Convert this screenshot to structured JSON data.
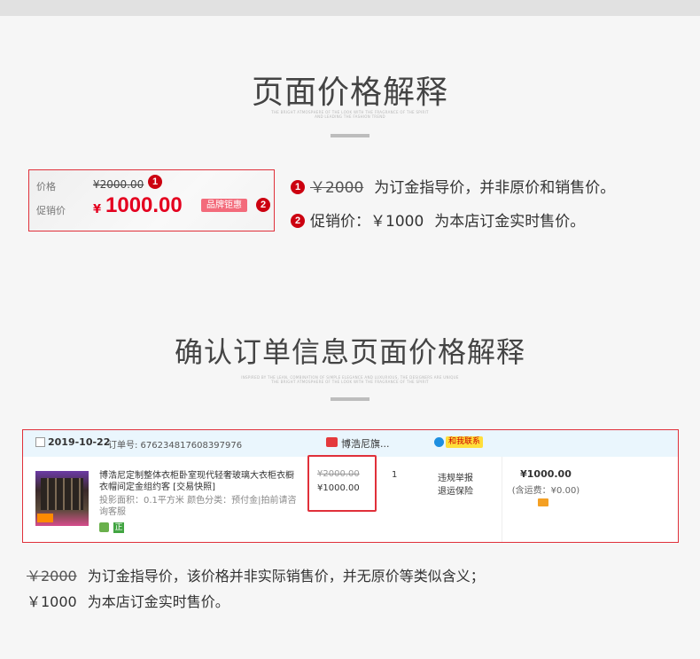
{
  "section1": {
    "title": "页面价格解释",
    "subtitle_lines": [
      "THE BRIGHT ATMOSPHERE OF THE LOOK WITH THE FRAGRANCE OF THE SPIRIT",
      "AND LEADING THE FASHION TREND"
    ],
    "price_box": {
      "price_label": "价格",
      "original_price": "¥2000.00",
      "promo_label": "促销价",
      "currency": "¥",
      "promo_price": "1000.00",
      "tag": "品牌钜惠",
      "marker1": "1",
      "marker2": "2"
    },
    "explanations": [
      {
        "marker": "1",
        "strike_value": "￥2000",
        "text": "为订金指导价，并非原价和销售价。"
      },
      {
        "marker": "2",
        "label": "促销价：",
        "value": "￥1000",
        "text": "为本店订金实时售价。"
      }
    ]
  },
  "section2": {
    "title": "确认订单信息页面价格解释",
    "subtitle_lines": [
      "INSPIRED BY THE LEAN, COMBINATION OF SIMPLE ELEGANCE AND LUXURIOUS, THE DESIGNERS ARE UNIQUE",
      "THE BRIGHT ATMOSPHERE OF THE LOOK WITH THE FRAGRANCE OF THE SPIRIT"
    ],
    "order": {
      "date": "2019-10-22",
      "order_no_label": "订单号: 676234817608397976",
      "shop_name": "博浩尼旗...",
      "chat_label": "和我联系",
      "product_title": "博浩尼定制整体衣柜卧室现代轻奢玻璃大衣柜衣橱衣帽间定金组约客 [交易快照]",
      "product_meta": "投影面积：0.1平方米  颜色分类：预付金|拍前请咨询客服",
      "badge_text": "正",
      "price_original": "¥2000.00",
      "price_now": "¥1000.00",
      "quantity": "1",
      "service1": "违规举报",
      "service2": "退运保险",
      "total": "¥1000.00",
      "shipping": "(含运费：¥0.00)"
    },
    "notes": [
      {
        "strike_value": "￥2000",
        "text": "为订金指导价，该价格并非实际销售价，并无原价等类似含义；"
      },
      {
        "value": "￥1000",
        "text": "为本店订金实时售价。"
      }
    ]
  }
}
